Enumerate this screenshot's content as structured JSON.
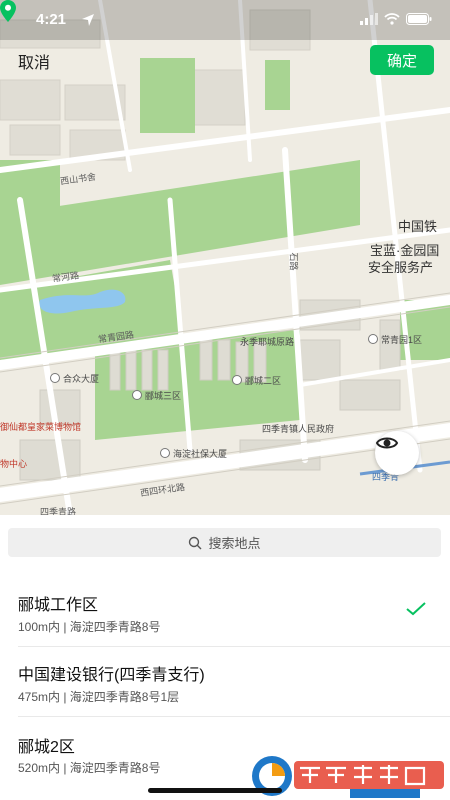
{
  "status": {
    "time": "4:21"
  },
  "header": {
    "cancel_label": "取消",
    "confirm_label": "确定"
  },
  "map": {
    "labels": {
      "xishanfu": "西山书舍",
      "china_rail": "中国铁",
      "baolan1": "宝蓝·金园国",
      "baolan2": "安全服务产",
      "changhe": "常河路",
      "changqing": "常青园路",
      "yongjiu": "永季耶城原路",
      "hehe": "合众大厦",
      "licheng2": "郦城二区",
      "licheng3": "郦城三区",
      "changqing1": "常青园1区",
      "museum": "御仙都皇家菜博物馆",
      "shopping": "物中心",
      "sijiqing_gov": "四季青镇人民政府",
      "haidian_social": "海淀社保大厦",
      "xisihuan": "西四环北路",
      "sijiqing_metro": "四季青",
      "shilu": "石路",
      "jianggong": "四季青路",
      "bottom_road": "四季青路"
    }
  },
  "search": {
    "placeholder": "搜索地点"
  },
  "results": [
    {
      "title": "郦城工作区",
      "subtitle": "100m内 | 海淀四季青路8号",
      "selected": true
    },
    {
      "title": "中国建设银行(四季青支行)",
      "subtitle": "475m内 | 海淀四季青路8号1层",
      "selected": false
    },
    {
      "title": "郦城2区",
      "subtitle": "520m内 | 海淀四季青路8号",
      "selected": false
    }
  ],
  "watermark": {
    "brand": "西西软件园",
    "url": "CR173.COM"
  },
  "colors": {
    "accent": "#07c160",
    "park": "#9fcf8a",
    "road": "#ffffff",
    "building": "#dcdad2"
  }
}
